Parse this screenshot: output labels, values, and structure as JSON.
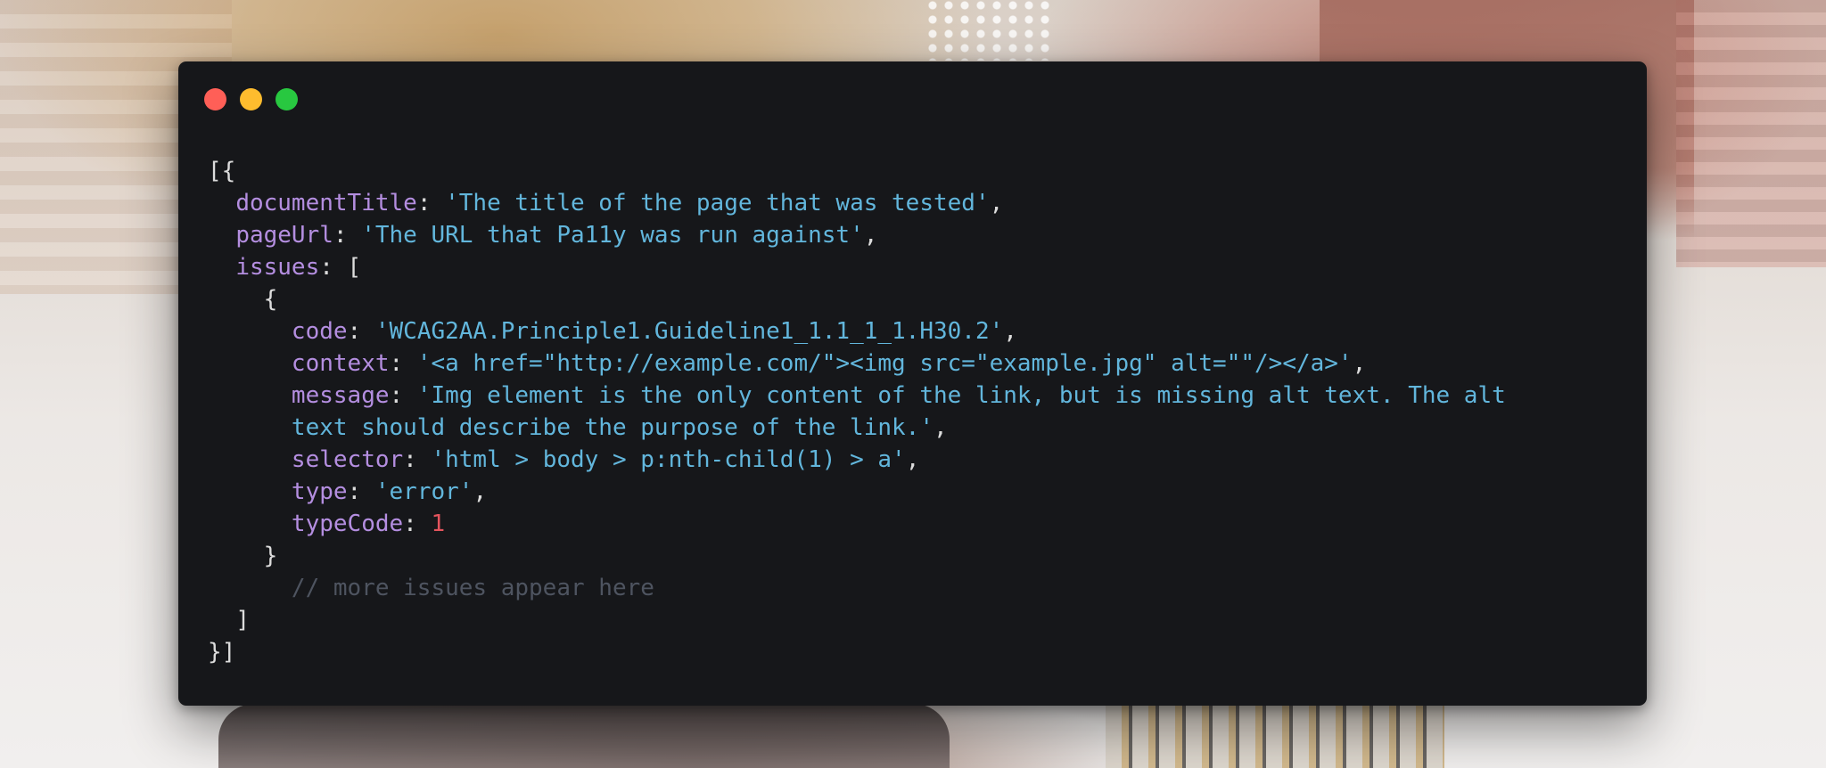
{
  "window": {
    "controls": {
      "close_color": "#ff5f57",
      "minimize_color": "#febc2e",
      "zoom_color": "#28c840"
    }
  },
  "code": {
    "open": "[{",
    "documentTitle": {
      "key": "documentTitle",
      "value": "'The title of the page that was tested'"
    },
    "pageUrl": {
      "key": "pageUrl",
      "value": "'The URL that Pa11y was run against'"
    },
    "issues_key": "issues",
    "issues_open": "[",
    "issue_open": "{",
    "issue": {
      "code": {
        "key": "code",
        "value": "'WCAG2AA.Principle1.Guideline1_1.1_1_1.H30.2'"
      },
      "context": {
        "key": "context",
        "value": "'<a href=\"http://example.com/\"><img src=\"example.jpg\" alt=\"\"/></a>'"
      },
      "message": {
        "key": "message",
        "value_line1": "'Img element is the only content of the link, but is missing alt text. The alt",
        "value_line2": "text should describe the purpose of the link.'"
      },
      "selector": {
        "key": "selector",
        "value": "'html > body > p:nth-child(1) > a'"
      },
      "type": {
        "key": "type",
        "value": "'error'"
      },
      "typeCode": {
        "key": "typeCode",
        "value": "1"
      }
    },
    "issue_close": "}",
    "comment": "// more issues appear here",
    "issues_close": "]",
    "close": "}]"
  },
  "syntax_colors": {
    "key": "#b48ee0",
    "string": "#62b6dc",
    "number": "#e3545d",
    "comment": "#4e5460",
    "punctuation": "#dcdcdc",
    "background": "#16171a"
  }
}
